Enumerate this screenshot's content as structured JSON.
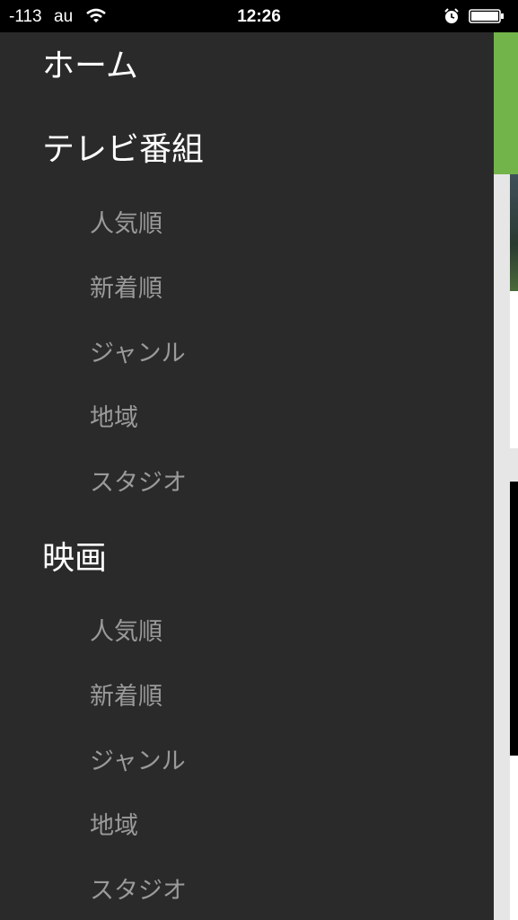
{
  "status_bar": {
    "signal": "-113",
    "carrier": "au",
    "time": "12:26",
    "wifi_icon": "wifi-icon",
    "alarm_icon": "alarm-icon",
    "battery_icon": "battery-icon"
  },
  "menu": {
    "home": "ホーム",
    "tv": {
      "label": "テレビ番組",
      "items": [
        "人気順",
        "新着順",
        "ジャンル",
        "地域",
        "スタジオ"
      ]
    },
    "movies": {
      "label": "映画",
      "items": [
        "人気順",
        "新着順",
        "ジャンル",
        "地域",
        "スタジオ"
      ]
    }
  },
  "colors": {
    "drawer_bg": "#2a2a2a",
    "section_text": "#ffffff",
    "sub_text": "#9a9a9a",
    "accent_green": "#72b34a"
  }
}
